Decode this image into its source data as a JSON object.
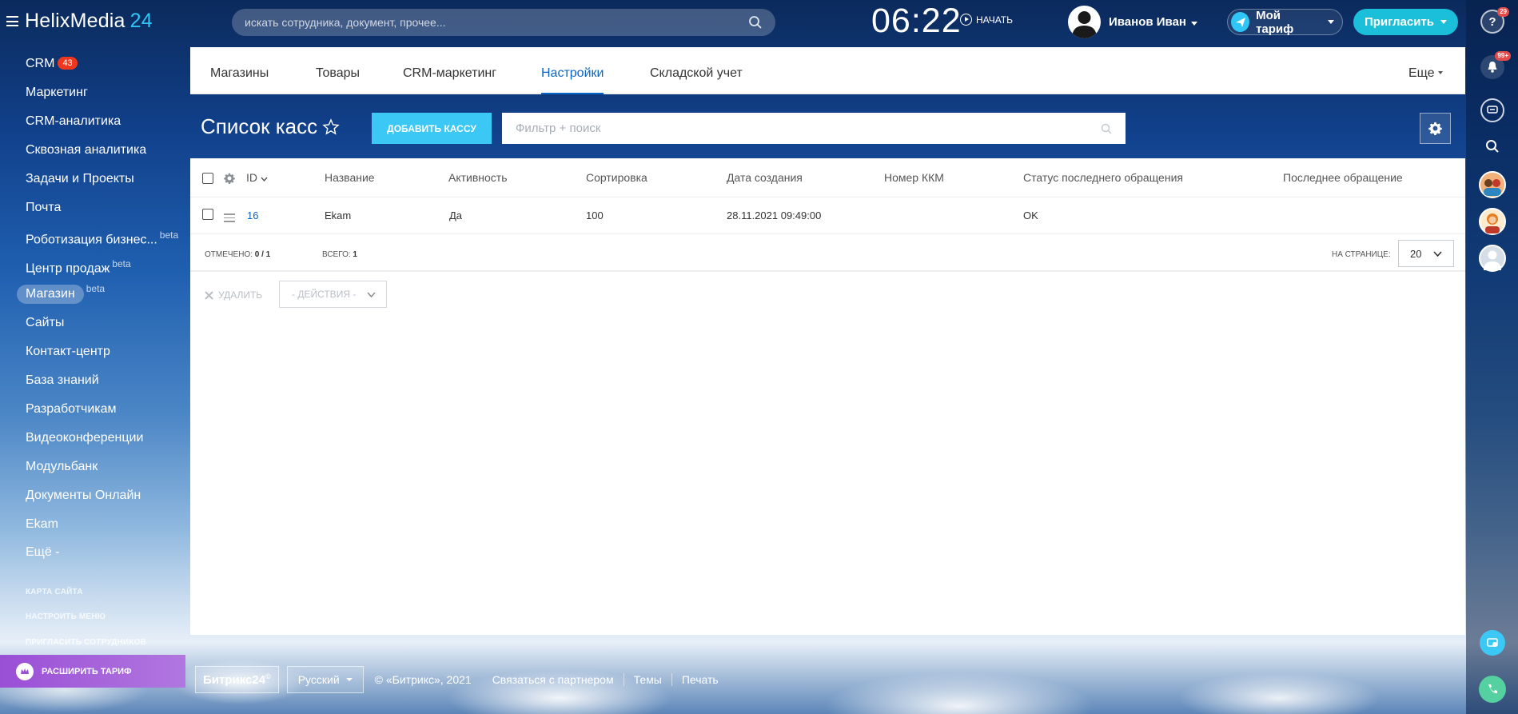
{
  "header": {
    "logo_main": "HelixMedia",
    "logo_num": "24",
    "search_placeholder": "искать сотрудника, документ, прочее...",
    "clock": "06:22",
    "start_label": "НАЧАТЬ",
    "user_name": "Иванов Иван",
    "tariff_label": "Мой тариф",
    "invite_label": "Пригласить"
  },
  "rightbar": {
    "help_badge": "29",
    "notif_badge": "99+"
  },
  "sidebar": {
    "items": [
      {
        "label": "CRM",
        "badge": "43"
      },
      {
        "label": "Маркетинг"
      },
      {
        "label": "CRM-аналитика"
      },
      {
        "label": "Сквозная аналитика"
      },
      {
        "label": "Задачи и Проекты"
      },
      {
        "label": "Почта"
      },
      {
        "label": "Роботизация бизнес...",
        "sup": "beta"
      },
      {
        "label": "Центр продаж",
        "sup": "beta"
      },
      {
        "label": "Магазин",
        "sup": "beta"
      },
      {
        "label": "Сайты"
      },
      {
        "label": "Контакт-центр"
      },
      {
        "label": "База знаний"
      },
      {
        "label": "Разработчикам"
      },
      {
        "label": "Видеоконференции"
      },
      {
        "label": "Модульбанк"
      },
      {
        "label": "Документы Онлайн"
      },
      {
        "label": "Ekam"
      },
      {
        "label": "Ещё -"
      }
    ],
    "links": [
      "КАРТА САЙТА",
      "НАСТРОИТЬ МЕНЮ",
      "ПРИГЛАСИТЬ СОТРУДНИКОВ"
    ],
    "upgrade_label": "РАСШИРИТЬ ТАРИФ"
  },
  "tabs": {
    "items": [
      "Магазины",
      "Товары",
      "CRM-маркетинг",
      "Настройки",
      "Складской учет"
    ],
    "more": "Еще"
  },
  "page": {
    "title": "Список касс",
    "add_button": "ДОБАВИТЬ КАССУ",
    "filter_placeholder": "Фильтр + поиск"
  },
  "grid": {
    "columns": [
      "ID",
      "Название",
      "Активность",
      "Сортировка",
      "Дата создания",
      "Номер ККМ",
      "Статус последнего обращения",
      "Последнее обращение"
    ],
    "rows": [
      {
        "id": "16",
        "name": "Ekam",
        "active": "Да",
        "sort": "100",
        "created": "28.11.2021 09:49:00",
        "kkm": "",
        "status": "OK",
        "last": ""
      }
    ],
    "selected_label": "ОТМЕЧЕНО:",
    "selected_value": "0 / 1",
    "total_label": "ВСЕГО:",
    "total_value": "1",
    "per_page_label": "НА СТРАНИЦЕ:",
    "per_page_value": "20",
    "delete_label": "УДАЛИТЬ",
    "actions_label": "- ДЕЙСТВИЯ -"
  },
  "footer": {
    "logo": "Битрикс24",
    "language": "Русский",
    "copyright": "© «Битрикс», 2021",
    "links": [
      "Связаться с партнером",
      "Темы",
      "Печать"
    ]
  }
}
